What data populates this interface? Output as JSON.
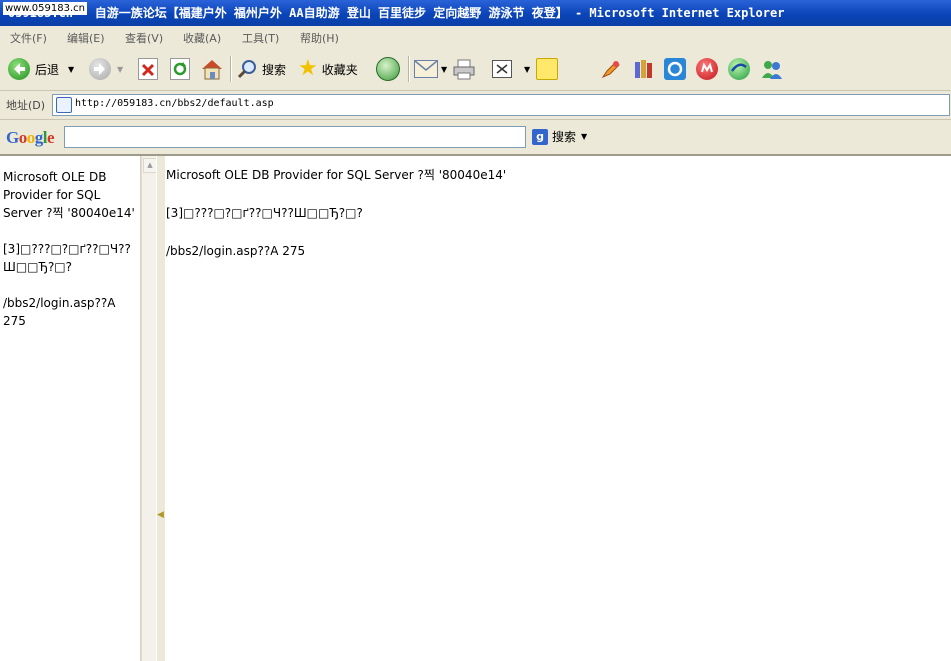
{
  "window": {
    "title": "059183.cn - 自游一族论坛【福建户外 福州户外 AA自助游 登山 百里徒步 定向越野 游泳节 夜登】 - Microsoft Internet Explorer",
    "watermark": "www.059183.cn"
  },
  "menu": {
    "items": [
      "文件(F)",
      "编辑(E)",
      "查看(V)",
      "收藏(A)",
      "工具(T)",
      "帮助(H)"
    ]
  },
  "toolbar": {
    "back_label": "后退",
    "search_label": "搜索",
    "favorites_label": "收藏夹"
  },
  "address": {
    "label": "地址(D)",
    "url": "http://059183.cn/bbs2/default.asp"
  },
  "google": {
    "logo": "Google",
    "search_label": "搜索",
    "query": ""
  },
  "left_frame": {
    "line1": "Microsoft OLE DB Provider for SQL Server ?찍 '80040e14'",
    "line2": "[3]□???□?□ґ??□Ч??Ш□□Ђ?□?",
    "line3": "/bbs2/login.asp??A 275"
  },
  "main_frame": {
    "line1": "Microsoft OLE DB Provider for SQL Server ?찍 '80040e14'",
    "line2": "[3]□???□?□ґ??□Ч??Ш□□Ђ?□?",
    "line3": "/bbs2/login.asp??A 275"
  },
  "colors": {
    "titlebar": "#0a44b8",
    "chrome": "#ece9d8",
    "google_blue": "#3366cc"
  }
}
